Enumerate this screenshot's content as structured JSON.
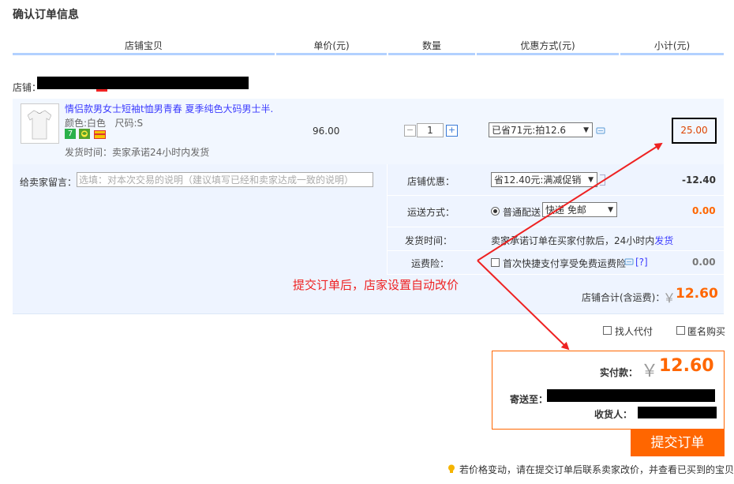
{
  "page": {
    "title": "确认订单信息"
  },
  "table_headers": [
    "店铺宝贝",
    "单价(元)",
    "数量",
    "优惠方式(元)",
    "小计(元)"
  ],
  "shop": {
    "label": "店铺："
  },
  "item": {
    "title": "情侣款男女士短袖t恤男青春 夏季纯色大码男士半...",
    "attrs": "颜色:白色   尺码:S",
    "ship_time": "发货时间：卖家承诺24小时内发货",
    "price": "96.00",
    "qty": "1",
    "qty_minus": "−",
    "qty_plus": "+",
    "discount_selected": "已省71元:拍12.6",
    "subtotal": "25.00"
  },
  "message": {
    "label": "给卖家留言：",
    "placeholder": "选填：对本次交易的说明（建议填写已经和卖家达成一致的说明）"
  },
  "shop_discount": {
    "label": "店铺优惠：",
    "selected": "省12.40元:满减促销",
    "amount": "-12.40"
  },
  "shipping": {
    "label": "运送方式：",
    "option": "普通配送",
    "selected": "快递 免邮",
    "amount": "0.00"
  },
  "delivery": {
    "label": "发货时间：",
    "text": "卖家承诺订单在买家付款后，24小时内",
    "link": "发货"
  },
  "insurance": {
    "label": "运费险：",
    "text": "首次快捷支付享受免费运费险",
    "help": "[?]",
    "amount": "0.00"
  },
  "shop_total": {
    "label": "店铺合计(含运费)：",
    "currency": "￥",
    "amount": "12.60"
  },
  "options": {
    "proxy_pay": "找人代付",
    "anonymous": "匿名购买"
  },
  "payment": {
    "label": "实付款：",
    "currency": "￥",
    "amount": "12.60",
    "ship_to_label": "寄送至：",
    "receiver_label": "收货人："
  },
  "submit_label": "提交订单",
  "annotation": "提交订单后，店家设置自动改价",
  "tip": "若价格变动，请在提交订单后联系卖家改价，并查看已买到的宝贝",
  "colors": {
    "accent": "#ff6600",
    "link": "#3c3cff",
    "annotation": "#ee2222",
    "header_line": "#b2d1ff"
  }
}
